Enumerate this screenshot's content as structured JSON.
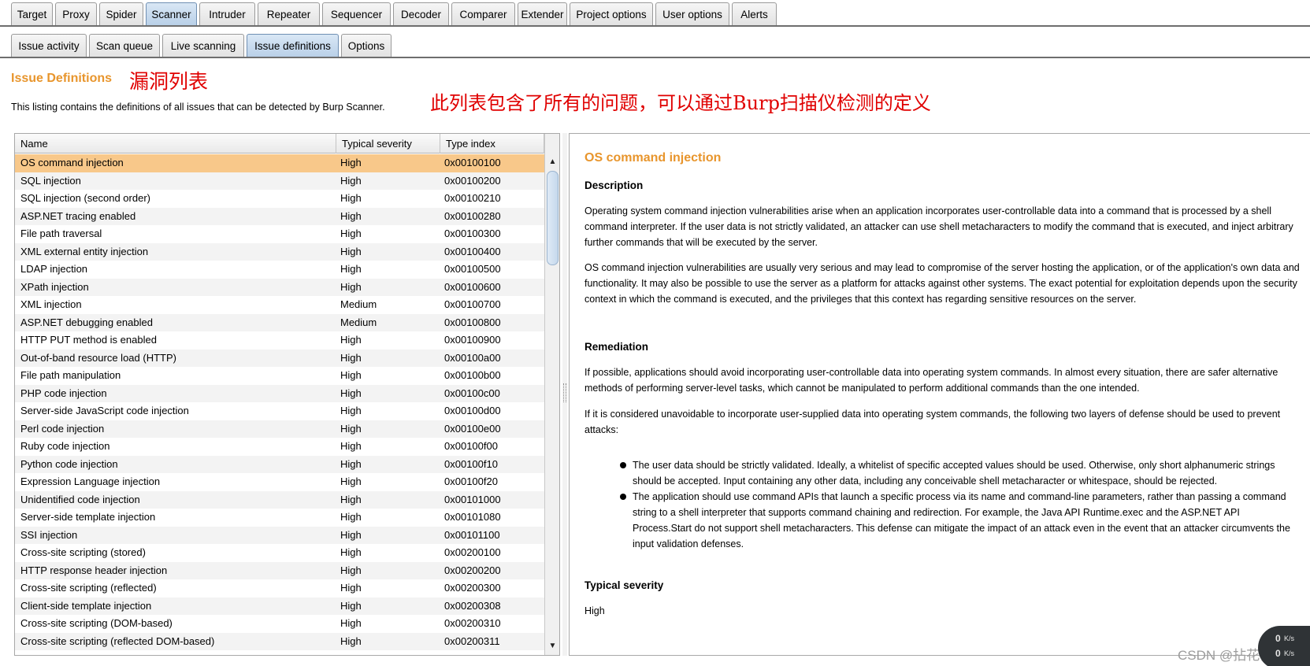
{
  "main_tabs": [
    {
      "label": "Target"
    },
    {
      "label": "Proxy"
    },
    {
      "label": "Spider"
    },
    {
      "label": "Scanner",
      "active": true
    },
    {
      "label": "Intruder"
    },
    {
      "label": "Repeater"
    },
    {
      "label": "Sequencer"
    },
    {
      "label": "Decoder"
    },
    {
      "label": "Comparer"
    },
    {
      "label": "Extender"
    },
    {
      "label": "Project options"
    },
    {
      "label": "User options"
    },
    {
      "label": "Alerts"
    }
  ],
  "sub_tabs": [
    {
      "label": "Issue activity"
    },
    {
      "label": "Scan queue"
    },
    {
      "label": "Live scanning"
    },
    {
      "label": "Issue definitions",
      "active": true
    },
    {
      "label": "Options"
    }
  ],
  "page": {
    "heading": "Issue Definitions",
    "annotation_title": "漏洞列表",
    "description": "This listing contains the definitions of all issues that can be detected by Burp Scanner.",
    "annotation_desc": "此列表包含了所有的问题，可以通过Burp扫描仪检测的定义"
  },
  "table": {
    "columns": [
      "Name",
      "Typical severity",
      "Type index"
    ],
    "rows": [
      [
        "OS command injection",
        "High",
        "0x00100100"
      ],
      [
        "SQL injection",
        "High",
        "0x00100200"
      ],
      [
        "SQL injection (second order)",
        "High",
        "0x00100210"
      ],
      [
        "ASP.NET tracing enabled",
        "High",
        "0x00100280"
      ],
      [
        "File path traversal",
        "High",
        "0x00100300"
      ],
      [
        "XML external entity injection",
        "High",
        "0x00100400"
      ],
      [
        "LDAP injection",
        "High",
        "0x00100500"
      ],
      [
        "XPath injection",
        "High",
        "0x00100600"
      ],
      [
        "XML injection",
        "Medium",
        "0x00100700"
      ],
      [
        "ASP.NET debugging enabled",
        "Medium",
        "0x00100800"
      ],
      [
        "HTTP PUT method is enabled",
        "High",
        "0x00100900"
      ],
      [
        "Out-of-band resource load (HTTP)",
        "High",
        "0x00100a00"
      ],
      [
        "File path manipulation",
        "High",
        "0x00100b00"
      ],
      [
        "PHP code injection",
        "High",
        "0x00100c00"
      ],
      [
        "Server-side JavaScript code injection",
        "High",
        "0x00100d00"
      ],
      [
        "Perl code injection",
        "High",
        "0x00100e00"
      ],
      [
        "Ruby code injection",
        "High",
        "0x00100f00"
      ],
      [
        "Python code injection",
        "High",
        "0x00100f10"
      ],
      [
        "Expression Language injection",
        "High",
        "0x00100f20"
      ],
      [
        "Unidentified code injection",
        "High",
        "0x00101000"
      ],
      [
        "Server-side template injection",
        "High",
        "0x00101080"
      ],
      [
        "SSI injection",
        "High",
        "0x00101100"
      ],
      [
        "Cross-site scripting (stored)",
        "High",
        "0x00200100"
      ],
      [
        "HTTP response header injection",
        "High",
        "0x00200200"
      ],
      [
        "Cross-site scripting (reflected)",
        "High",
        "0x00200300"
      ],
      [
        "Client-side template injection",
        "High",
        "0x00200308"
      ],
      [
        "Cross-site scripting (DOM-based)",
        "High",
        "0x00200310"
      ],
      [
        "Cross-site scripting (reflected DOM-based)",
        "High",
        "0x00200311"
      ]
    ],
    "selected_index": 0
  },
  "detail": {
    "title": "OS command injection",
    "description_heading": "Description",
    "description_p1": "Operating system command injection vulnerabilities arise when an application incorporates user-controllable data into a command that is processed by a shell command interpreter. If the user data is not strictly validated, an attacker can use shell metacharacters to modify the command that is executed, and inject arbitrary further commands that will be executed by the server.",
    "description_p2": "OS command injection vulnerabilities are usually very serious and may lead to compromise of the server hosting the application, or of the application's own data and functionality. It may also be possible to use the server as a platform for attacks against other systems. The exact potential for exploitation depends upon the security context in which the command is executed, and the privileges that this context has regarding sensitive resources on the server.",
    "remediation_heading": "Remediation",
    "remediation_p1": "If possible, applications should avoid incorporating user-controllable data into operating system commands. In almost every situation, there are safer alternative methods of performing server-level tasks, which cannot be manipulated to perform additional commands than the one intended.",
    "remediation_p2": "If it is considered unavoidable to incorporate user-supplied data into operating system commands, the following two layers of defense should be used to prevent attacks:",
    "remediation_bullets": [
      "The user data should be strictly validated. Ideally, a whitelist of specific accepted values should be used. Otherwise, only short alphanumeric strings should be accepted. Input containing any other data, including any conceivable shell metacharacter or whitespace, should be rejected.",
      "The application should use command APIs that launch a specific process via its name and command-line parameters, rather than passing a command string to a shell interpreter that supports command chaining and redirection. For example, the Java API Runtime.exec and the ASP.NET API Process.Start do not support shell metacharacters. This defense can mitigate the impact of an attack even in the event that an attacker circumvents the input validation defenses."
    ],
    "severity_heading": "Typical severity",
    "severity_value": "High"
  },
  "scroll": {
    "up_arrow": "▲",
    "down_arrow": "▼"
  },
  "overlay": {
    "watermark": "CSDN @拈花倾城",
    "speed_up": "0",
    "speed_up_unit": "K/s",
    "speed_down": "0",
    "speed_down_unit": "K/s"
  }
}
